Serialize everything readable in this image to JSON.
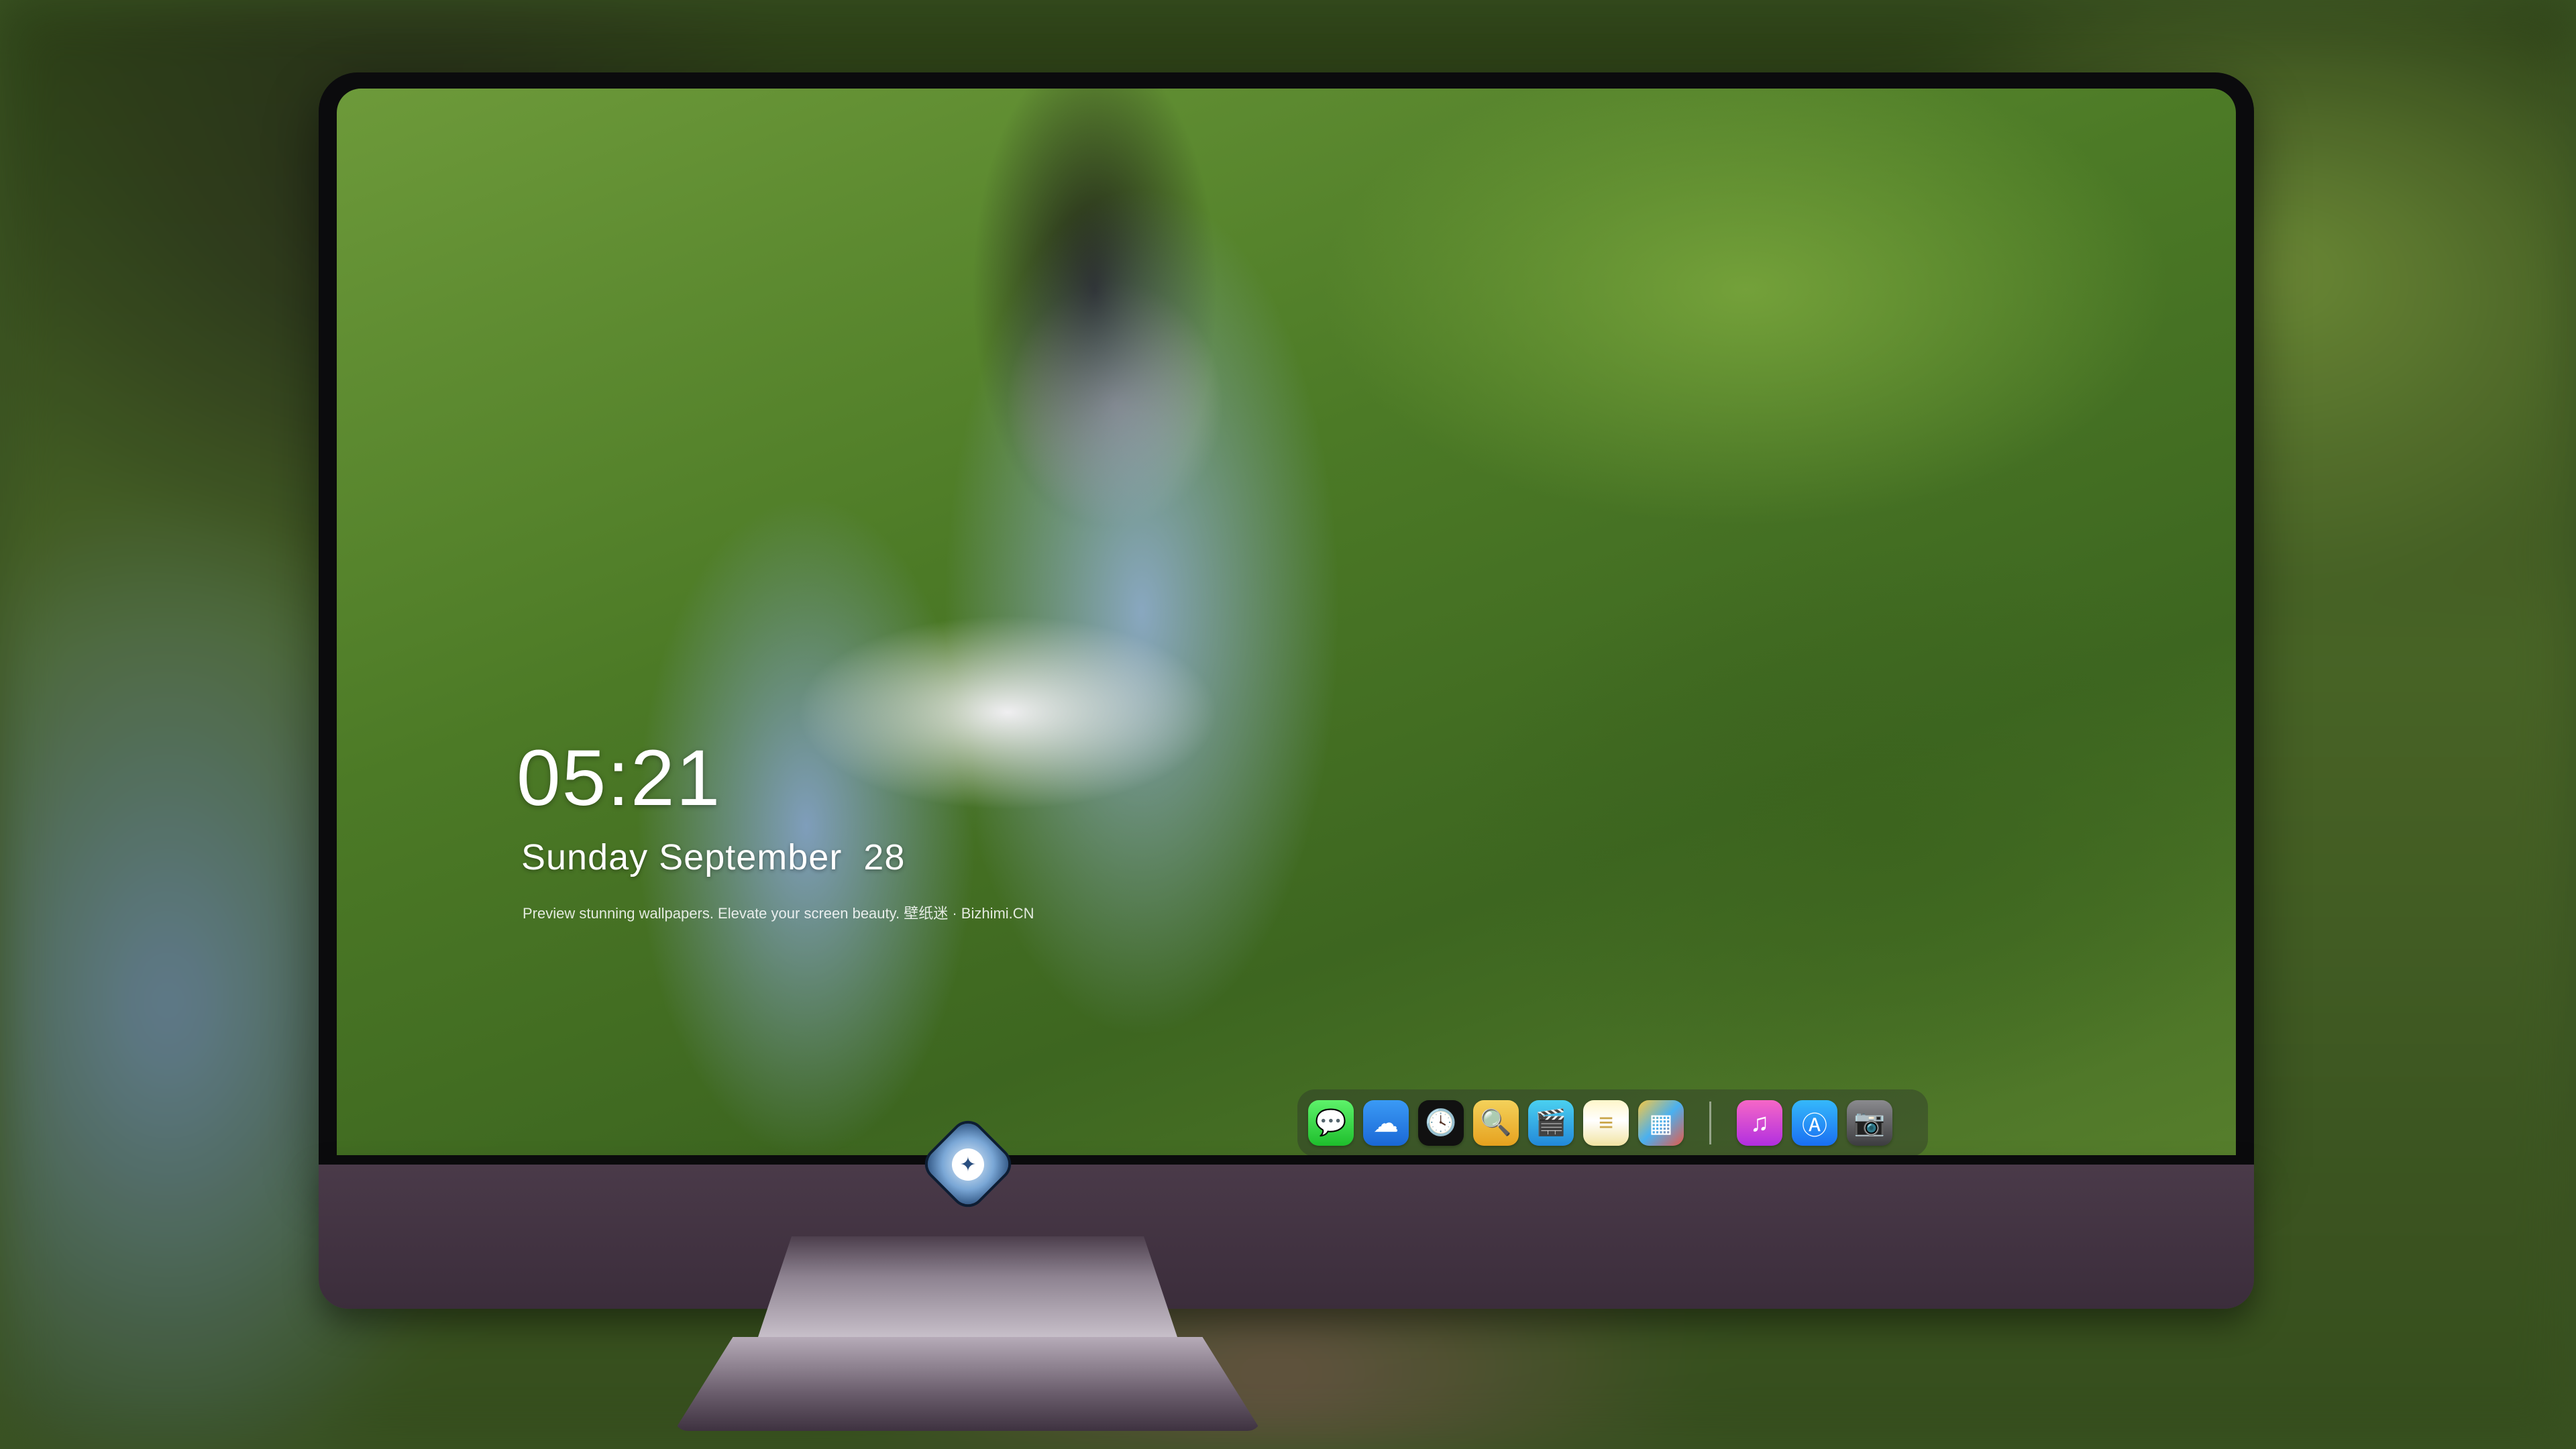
{
  "lockscreen": {
    "time": "05:21",
    "date": "Sunday September  28",
    "tagline": "Preview stunning wallpapers. Elevate your screen beauty. 壁纸迷 · Bizhimi.CN"
  },
  "dock": {
    "apps": [
      {
        "name": "Messages",
        "icon": "💬"
      },
      {
        "name": "Weather",
        "icon": "☁"
      },
      {
        "name": "Clock",
        "icon": "🕓"
      },
      {
        "name": "Preview",
        "icon": "🔍"
      },
      {
        "name": "Clips",
        "icon": "🎬"
      },
      {
        "name": "Notes",
        "icon": "≡"
      },
      {
        "name": "Photo Booth",
        "icon": "▦"
      },
      {
        "name": "Music",
        "icon": "♫"
      },
      {
        "name": "App Store",
        "icon": "Ⓐ"
      },
      {
        "name": "Camera",
        "icon": "📷"
      }
    ]
  },
  "colors": {
    "bezel": "#0b0b0d",
    "chin": "#4a3a49",
    "grass": "#4c7a26"
  }
}
